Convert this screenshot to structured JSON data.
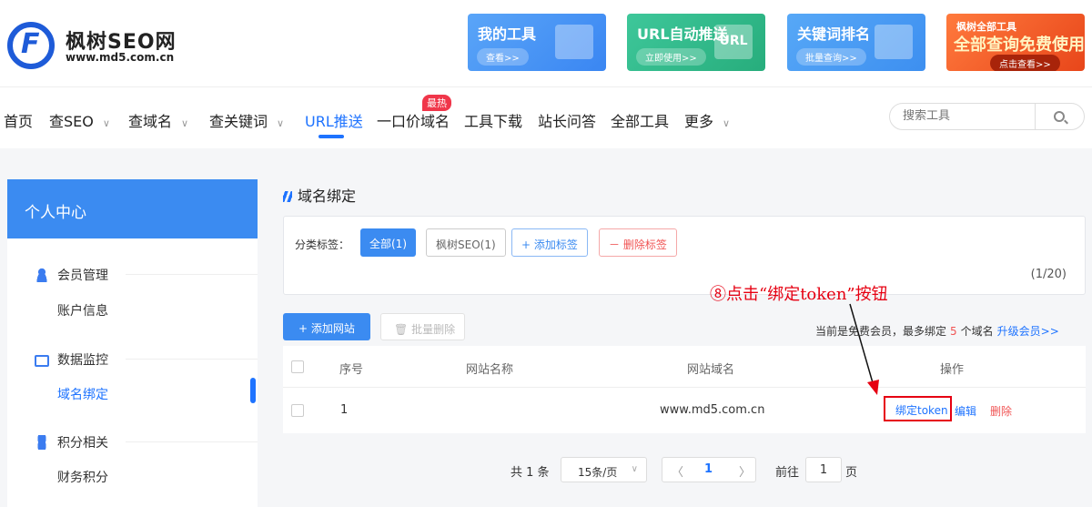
{
  "header": {
    "logo_name": "枫树SEO网",
    "logo_url": "www.md5.com.cn",
    "banners": [
      {
        "title": "我的工具",
        "button": "查看>>"
      },
      {
        "title": "URL自动推送",
        "button": "立即使用>>",
        "deco_text": "URL"
      },
      {
        "title": "关键词排名",
        "button": "批量查询>>"
      },
      {
        "title": "枫树全部工具",
        "title2": "全部查询免费使用",
        "button": "点击查看>>"
      }
    ]
  },
  "nav": {
    "items": [
      "首页",
      "查SEO",
      "查域名",
      "查关键词",
      "URL推送",
      "一口价域名",
      "工具下载",
      "站长问答",
      "全部工具",
      "更多"
    ],
    "hot_badge": "最热",
    "search_placeholder": "搜索工具"
  },
  "sidebar": {
    "title": "个人中心",
    "groups": [
      {
        "label": "会员管理",
        "items": [
          "账户信息"
        ]
      },
      {
        "label": "数据监控",
        "items": [
          "域名绑定"
        ]
      },
      {
        "label": "积分相关",
        "items": [
          "财务积分"
        ]
      }
    ]
  },
  "main": {
    "title": "域名绑定",
    "category_label": "分类标签：",
    "chips": [
      "全部(1)",
      "枫树SEO(1)",
      "+ 添加标签",
      "－ 删除标签"
    ],
    "category_count": "(1/20)",
    "add_site": "+ 添加网站",
    "batch_delete": "批量删除",
    "member_note_prefix": "当前是免费会员，最多绑定",
    "member_limit": "5",
    "member_note_suffix": "个域名",
    "upgrade": "升级会员>>",
    "table": {
      "headers": [
        "序号",
        "网站名称",
        "网站域名",
        "操作"
      ],
      "rows": [
        {
          "index": "1",
          "name": "",
          "domain": "www.md5.com.cn",
          "ops": [
            "绑定token",
            "编辑",
            "删除"
          ]
        }
      ]
    },
    "annotation": "⑧点击“绑定token”按钮",
    "pagination": {
      "total": "共 1 条",
      "page_size": "15条/页",
      "current": "1",
      "goto_label": "前往",
      "goto_value": "1",
      "goto_unit": "页"
    }
  },
  "colors": {
    "accent": "#3b8bf1",
    "annotation": "#e60012",
    "danger": "#f05454"
  }
}
